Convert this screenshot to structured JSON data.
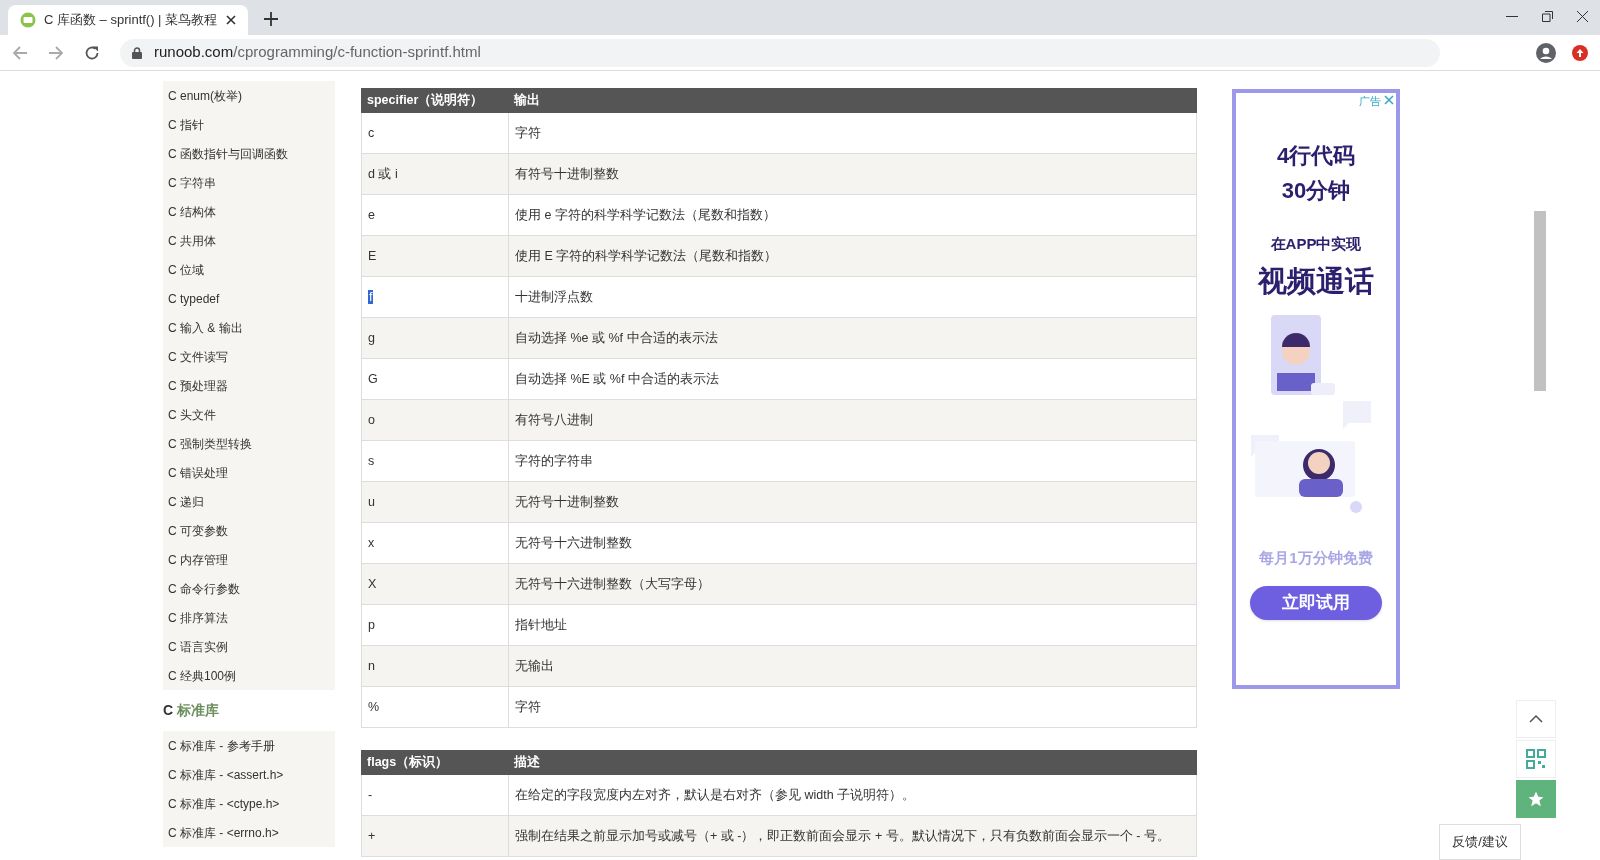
{
  "browser": {
    "tab": {
      "title": "C 库函数 – sprintf() | 菜鸟教程",
      "selected": true
    },
    "url": {
      "host": "runoob.com",
      "path": "/cprogramming/c-function-sprintf.html"
    }
  },
  "sidebar": {
    "items": [
      "C enum(枚举)",
      "C 指针",
      "C 函数指针与回调函数",
      "C 字符串",
      "C 结构体",
      "C 共用体",
      "C 位域",
      "C typedef",
      "C 输入 & 输出",
      "C 文件读写",
      "C 预处理器",
      "C 头文件",
      "C 强制类型转换",
      "C 错误处理",
      "C 递归",
      "C 可变参数",
      "C 内存管理",
      "C 命令行参数",
      "C 排序算法",
      "C 语言实例",
      "C 经典100例"
    ],
    "section": {
      "prefix": "C",
      "title": "标准库"
    },
    "section_items": [
      "C 标准库 - 参考手册",
      "C 标准库 - <assert.h>",
      "C 标准库 - <ctype.h>",
      "C 标准库 - <errno.h>"
    ]
  },
  "tables": [
    {
      "columns": [
        "specifier（说明符）",
        "输出"
      ],
      "rows": [
        {
          "cells": [
            "c",
            "字符"
          ],
          "selected": false
        },
        {
          "cells": [
            "d 或 i",
            "有符号十进制整数"
          ],
          "selected": false
        },
        {
          "cells": [
            "e",
            "使用 e 字符的科学科学记数法（尾数和指数）"
          ],
          "selected": false
        },
        {
          "cells": [
            "E",
            "使用 E 字符的科学科学记数法（尾数和指数）"
          ],
          "selected": false
        },
        {
          "cells": [
            "f",
            "十进制浮点数"
          ],
          "selected": true
        },
        {
          "cells": [
            "g",
            "自动选择 %e 或 %f 中合适的表示法"
          ],
          "selected": false
        },
        {
          "cells": [
            "G",
            "自动选择 %E 或 %f 中合适的表示法"
          ],
          "selected": false
        },
        {
          "cells": [
            "o",
            "有符号八进制"
          ],
          "selected": false
        },
        {
          "cells": [
            "s",
            "字符的字符串"
          ],
          "selected": false
        },
        {
          "cells": [
            "u",
            "无符号十进制整数"
          ],
          "selected": false
        },
        {
          "cells": [
            "x",
            "无符号十六进制整数"
          ],
          "selected": false
        },
        {
          "cells": [
            "X",
            "无符号十六进制整数（大写字母）"
          ],
          "selected": false
        },
        {
          "cells": [
            "p",
            "指针地址"
          ],
          "selected": false
        },
        {
          "cells": [
            "n",
            "无输出"
          ],
          "selected": false
        },
        {
          "cells": [
            "%",
            "字符"
          ],
          "selected": false
        }
      ]
    },
    {
      "columns": [
        "flags（标识）",
        "描述"
      ],
      "rows": [
        {
          "cells": [
            "-",
            "在给定的字段宽度内左对齐，默认是右对齐（参见 width 子说明符）。"
          ],
          "selected": false
        },
        {
          "cells": [
            "+",
            "强制在结果之前显示加号或减号（+ 或 -），即正数前面会显示 + 号。默认情况下，只有负数前面会显示一个 - 号。"
          ],
          "selected": false
        }
      ]
    }
  ],
  "ad": {
    "badge": "广告",
    "line_1": "4行代码",
    "line_2": "30分钟",
    "line_3": "在APP中实现",
    "headline": "视频通话",
    "offer": "每月1万分钟免费",
    "button": "立即试用"
  },
  "feedback": "反馈/建议"
}
